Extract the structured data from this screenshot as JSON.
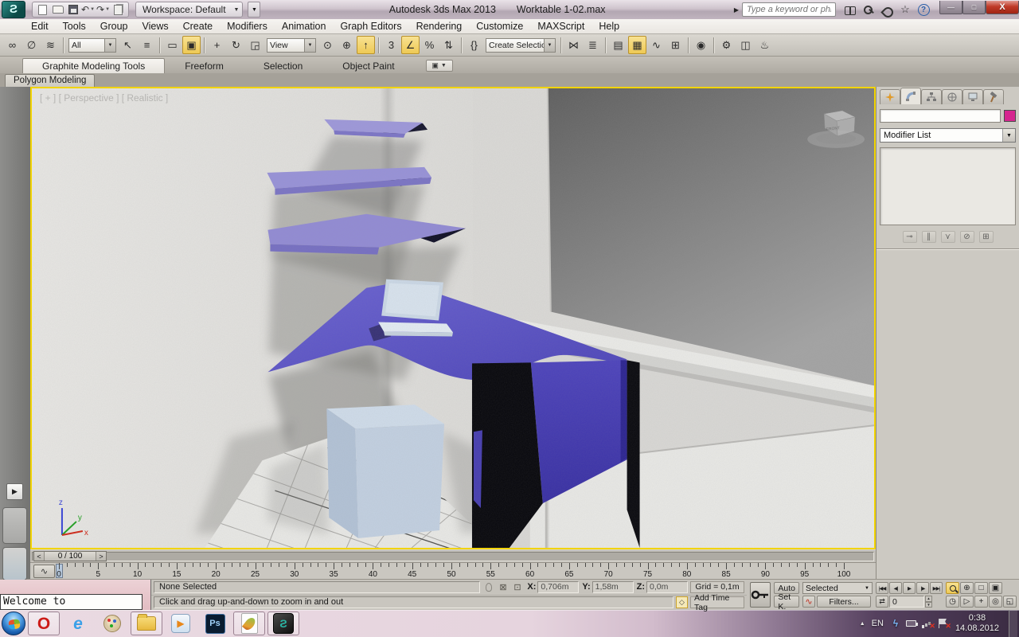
{
  "titlebar": {
    "logo_letter": "Ƨ",
    "app_title": "Autodesk 3ds Max 2013",
    "file_title": "Worktable 1-02.max",
    "workspace_label": "Workspace: Default",
    "search_placeholder": "Type a keyword or phrase",
    "qat": [
      {
        "name": "new-scene-icon",
        "cls": "ic-page"
      },
      {
        "name": "open-file-icon",
        "cls": "ic-folder"
      },
      {
        "name": "save-file-icon",
        "cls": "ic-floppy"
      },
      {
        "name": "undo-icon",
        "glyph": "↶",
        "dropdown": true
      },
      {
        "name": "redo-icon",
        "glyph": "↷",
        "dropdown": true
      },
      {
        "name": "project-folder-icon",
        "cls": "ic-clip"
      }
    ],
    "help_icons": [
      {
        "name": "search-communities-icon",
        "cls": "ic-binoc"
      },
      {
        "name": "sign-in-key-icon",
        "cls": "ic-key"
      },
      {
        "name": "communication-center-icon",
        "cls": "ic-sat"
      },
      {
        "name": "favorites-star-icon",
        "glyph": "☆"
      },
      {
        "name": "help-icon",
        "cls": "ic-help",
        "glyph": "?",
        "dropdown": true
      }
    ],
    "window_buttons": [
      {
        "name": "minimize-button",
        "glyph": "—",
        "cls2": "min"
      },
      {
        "name": "maximize-button",
        "glyph": "□",
        "cls2": "max"
      },
      {
        "name": "close-button",
        "glyph": "X",
        "cls2": "close"
      }
    ]
  },
  "menu": {
    "items": [
      "Edit",
      "Tools",
      "Group",
      "Views",
      "Create",
      "Modifiers",
      "Animation",
      "Graph Editors",
      "Rendering",
      "Customize",
      "MAXScript",
      "Help"
    ]
  },
  "toolbar": {
    "items": [
      {
        "type": "icon",
        "name": "select-and-link-icon",
        "glyph": "∞"
      },
      {
        "type": "icon",
        "name": "unlink-selection-icon",
        "glyph": "∅"
      },
      {
        "type": "icon",
        "name": "bind-to-space-warp-icon",
        "glyph": "≋"
      },
      {
        "type": "sep"
      },
      {
        "type": "combo",
        "name": "selection-filter-combo",
        "value": "All",
        "width": 60
      },
      {
        "type": "icon",
        "name": "select-object-icon",
        "glyph": "↖"
      },
      {
        "type": "icon",
        "name": "select-by-name-icon",
        "glyph": "≡"
      },
      {
        "type": "sep"
      },
      {
        "type": "icon",
        "name": "selection-region-icon",
        "glyph": "▭"
      },
      {
        "type": "icon",
        "name": "window-crossing-toggle-icon",
        "glyph": "▣",
        "hl": true
      },
      {
        "type": "sep"
      },
      {
        "type": "icon",
        "name": "select-and-move-icon",
        "glyph": "+"
      },
      {
        "type": "icon",
        "name": "select-and-rotate-icon",
        "glyph": "↻"
      },
      {
        "type": "icon",
        "name": "select-and-scale-icon",
        "glyph": "◲"
      },
      {
        "type": "combo",
        "name": "reference-coordinate-combo",
        "value": "View",
        "width": 62
      },
      {
        "type": "icon",
        "name": "use-pivot-center-icon",
        "glyph": "⊙"
      },
      {
        "type": "icon",
        "name": "select-and-manipulate-icon",
        "glyph": "⊕"
      },
      {
        "type": "icon",
        "name": "keyboard-override-toggle-icon",
        "glyph": "↑",
        "hl": true
      },
      {
        "type": "sep"
      },
      {
        "type": "icon",
        "name": "snap-toggle-3d-icon",
        "glyph": "3"
      },
      {
        "type": "icon",
        "name": "angle-snap-toggle-icon",
        "glyph": "∠",
        "hl": true
      },
      {
        "type": "icon",
        "name": "percent-snap-toggle-icon",
        "glyph": "%"
      },
      {
        "type": "icon",
        "name": "spinner-snap-toggle-icon",
        "glyph": "⇅"
      },
      {
        "type": "sep"
      },
      {
        "type": "icon",
        "name": "edit-named-sets-icon",
        "glyph": "{}"
      },
      {
        "type": "combo",
        "name": "named-sets-combo",
        "value": "Create Selection Se",
        "width": 88
      },
      {
        "type": "sep"
      },
      {
        "type": "icon",
        "name": "mirror-icon",
        "glyph": "⋈"
      },
      {
        "type": "icon",
        "name": "align-icon",
        "glyph": "≣"
      },
      {
        "type": "sep"
      },
      {
        "type": "icon",
        "name": "layer-manager-icon",
        "glyph": "▤"
      },
      {
        "type": "icon",
        "name": "ribbon-toggle-icon",
        "glyph": "▦",
        "hl": true
      },
      {
        "type": "icon",
        "name": "curve-editor-icon",
        "glyph": "∿"
      },
      {
        "type": "icon",
        "name": "schematic-view-icon",
        "glyph": "⊞"
      },
      {
        "type": "sep"
      },
      {
        "type": "icon",
        "name": "material-editor-icon",
        "glyph": "◉"
      },
      {
        "type": "sep"
      },
      {
        "type": "icon",
        "name": "render-setup-icon",
        "glyph": "⚙"
      },
      {
        "type": "icon",
        "name": "rendered-frame-window-icon",
        "glyph": "◫"
      },
      {
        "type": "icon",
        "name": "render-production-icon",
        "glyph": "♨"
      }
    ]
  },
  "ribbon": {
    "tabs": [
      {
        "label": "Graphite Modeling Tools",
        "active": true
      },
      {
        "label": "Freeform",
        "active": false
      },
      {
        "label": "Selection",
        "active": false
      },
      {
        "label": "Object Paint",
        "active": false
      }
    ],
    "subtab": "Polygon Modeling"
  },
  "viewport": {
    "label": "[ + ] [ Perspective ] [ Realistic ]",
    "viewcube_front_label": "FRONT",
    "axis_labels": {
      "x": "x",
      "y": "y",
      "z": "z"
    },
    "scene_colors": {
      "border": "#f2d400",
      "wall": "#e0dfdc",
      "dark_panel": "#636363",
      "shelf": "#978fd8",
      "shelf_edge": "#7b74c6",
      "desk_top": "#6059cc",
      "cabinet": "#4238ac",
      "black": "#06060a",
      "cube_top": "#cfdcea",
      "cube_front": "#c2d0e1",
      "cube_side": "#b2c2d6",
      "laptop": "#cbd8e6",
      "floor": "#e9e9e6",
      "sill": "#ebebe8",
      "bench": "#e9e9e6"
    }
  },
  "command_panel": {
    "tabs": [
      "create-tab",
      "modify-tab",
      "hierarchy-tab",
      "motion-tab",
      "display-tab",
      "utilities-tab"
    ],
    "object_name_value": "",
    "object_color": "#d6258f",
    "modifier_list_label": "Modifier List",
    "stack_buttons": [
      {
        "name": "pin-stack-button",
        "glyph": "⊸"
      },
      {
        "name": "show-end-result-button",
        "glyph": "∥"
      },
      {
        "name": "make-unique-button",
        "glyph": "⋎"
      },
      {
        "name": "remove-modifier-button",
        "glyph": "⊘"
      },
      {
        "name": "configure-modifier-sets-button",
        "glyph": "⊞"
      }
    ]
  },
  "time_slider": {
    "value": "0 / 100",
    "prev_glyph": "<",
    "next_glyph": ">"
  },
  "trackbar": {
    "min": 0,
    "max": 100,
    "label_step": 5
  },
  "status_bar": {
    "welcome_title": "Welcome to",
    "selection_status": "None Selected",
    "prompt": "Click and drag up-and-down to zoom in and out",
    "coords": [
      {
        "label": "X:",
        "value": "0,706m"
      },
      {
        "label": "Y:",
        "value": "1,58m"
      },
      {
        "label": "Z:",
        "value": "0,0m"
      }
    ],
    "grid_label": "Grid = 0,1m",
    "add_time_tag": "Add Time Tag"
  },
  "animation": {
    "auto_label": "Auto",
    "set_key_label": "Set K.",
    "key_filter_value": "Selected",
    "filters_label": "Filters...",
    "frame_value": "0",
    "playback": [
      {
        "name": "go-to-start-button",
        "glyph": "|◀◀"
      },
      {
        "name": "previous-frame-button",
        "glyph": "◀|"
      },
      {
        "name": "play-button",
        "glyph": "▶"
      },
      {
        "name": "next-frame-button",
        "glyph": "|▶"
      },
      {
        "name": "go-to-end-button",
        "glyph": "▶▶|"
      }
    ],
    "key_mode_glyph": "⇄",
    "nav_row1": [
      {
        "name": "zoom-button",
        "cls": "mag",
        "hl": true
      },
      {
        "name": "zoom-all-button",
        "glyph": "⊕"
      },
      {
        "name": "zoom-extents-button",
        "glyph": "□"
      },
      {
        "name": "zoom-extents-all-button",
        "glyph": "▣"
      }
    ],
    "nav_row2": [
      {
        "name": "time-configuration-button",
        "glyph": "◷"
      },
      {
        "name": "field-of-view-button",
        "glyph": "▷"
      },
      {
        "name": "pan-button",
        "glyph": "+"
      },
      {
        "name": "orbit-button",
        "glyph": "◎"
      },
      {
        "name": "maximize-viewport-button",
        "glyph": "◱"
      }
    ]
  },
  "taskbar": {
    "apps": [
      {
        "name": "start-button",
        "cls": "tb-start",
        "orb": true
      },
      {
        "name": "opera",
        "icls": "tb-opera",
        "glyph": "O",
        "boxed": true
      },
      {
        "name": "internet-explorer",
        "icls": "tb-ie",
        "glyph": "e"
      },
      {
        "name": "paint",
        "icls": "tb-paint"
      },
      {
        "name": "file-explorer",
        "icls": "tb-folder",
        "boxed": true
      },
      {
        "name": "media-player",
        "icls": "tb-wmp",
        "glyph": "▶"
      },
      {
        "name": "photoshop",
        "icls": "tb-ps",
        "glyph": "Ps"
      },
      {
        "name": "photoshop-elements",
        "icls": "tb-feather",
        "boxed": true
      },
      {
        "name": "3ds-max",
        "icls": "tb-max",
        "glyph": "Ƨ",
        "boxed": true
      }
    ],
    "tray": {
      "language": "EN",
      "expand_glyph": "▲",
      "icons": [
        {
          "name": "power-icon",
          "icls": "tr-power",
          "glyph": "ϟ"
        },
        {
          "name": "battery-icon",
          "icls": "tr-batt"
        },
        {
          "name": "network-icon",
          "icls": "tr-net",
          "error": true
        },
        {
          "name": "action-center-icon",
          "icls": "tr-flag",
          "error": true
        }
      ],
      "time": "0:38",
      "date": "14.08.2012"
    }
  }
}
